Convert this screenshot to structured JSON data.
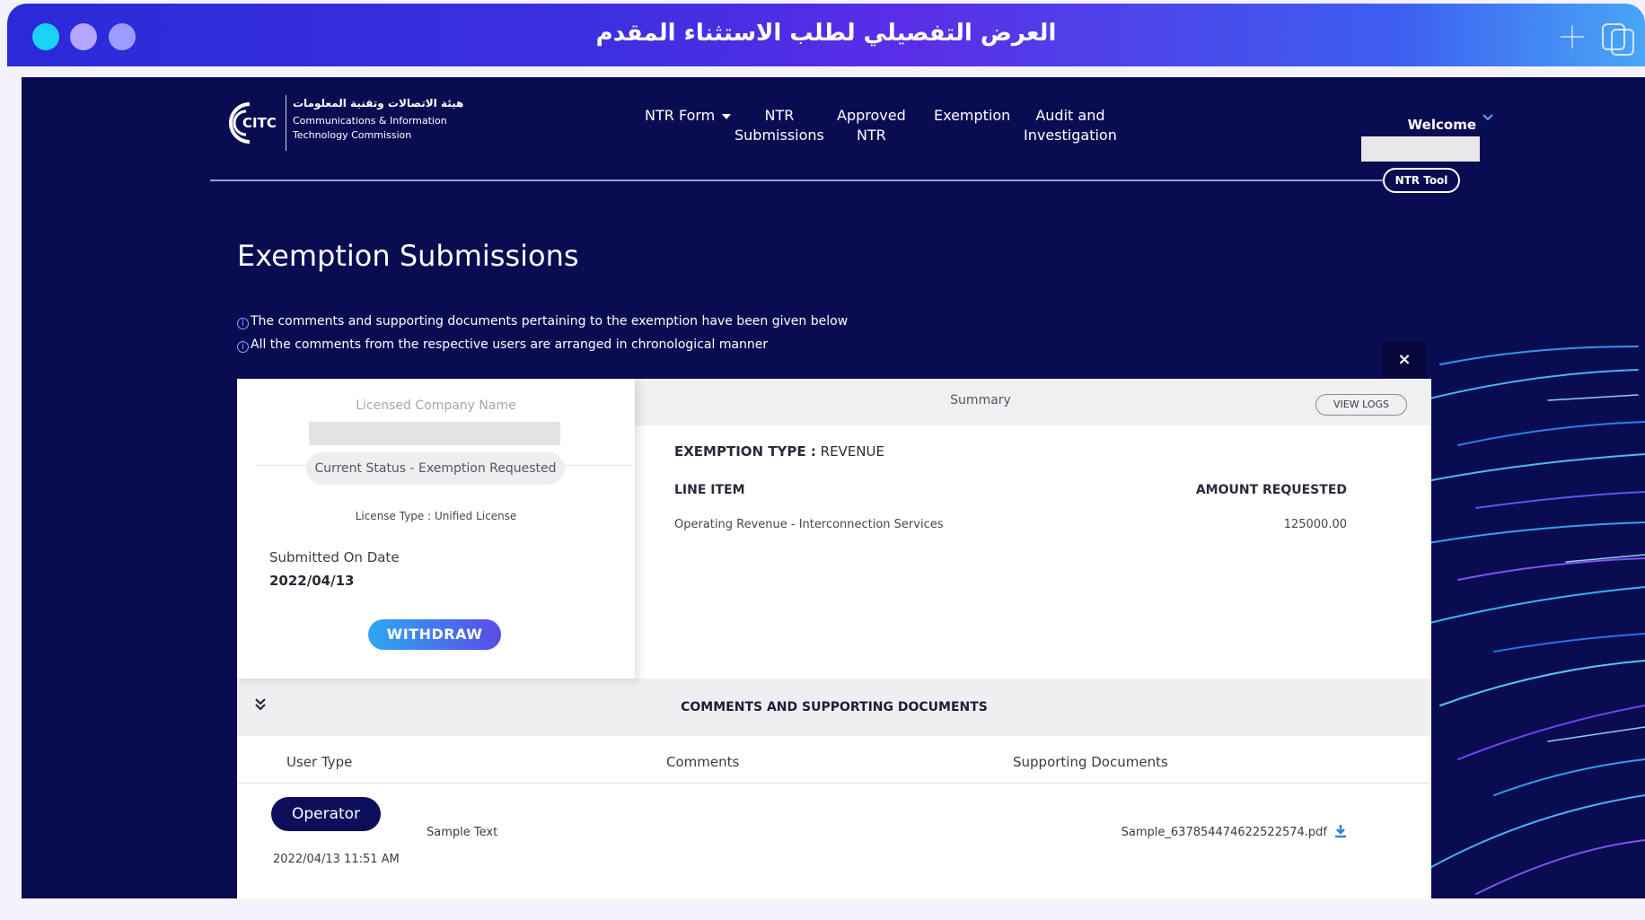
{
  "window": {
    "title": "العرض التفصيلي لطلب الاستثناء المقدم",
    "controls": [
      "close-dot",
      "minimize-dot",
      "maximize-dot"
    ],
    "accent_colors": {
      "dot1": "#19d3f5",
      "dot2": "#b7a4ff",
      "dot3": "#9b9cff"
    }
  },
  "header": {
    "logo": {
      "mark": "CITC",
      "arabic": "هيئة الاتصالات وتقنية المعلومات",
      "english_line1": "Communications & Information",
      "english_line2": "Technology Commission"
    },
    "nav": [
      {
        "line1": "NTR Form",
        "line2": "",
        "has_dropdown": true
      },
      {
        "line1": "NTR",
        "line2": "Submissions",
        "has_dropdown": false
      },
      {
        "line1": "Approved",
        "line2": "NTR",
        "has_dropdown": false
      },
      {
        "line1": "Exemption",
        "line2": "",
        "has_dropdown": false
      },
      {
        "line1": "Audit and",
        "line2": "Investigation",
        "has_dropdown": false
      }
    ],
    "welcome": "Welcome",
    "ntr_tool": "NTR Tool"
  },
  "page": {
    "title": "Exemption Submissions",
    "info_lines": [
      "The comments and supporting documents pertaining to the exemption have been given below",
      "All the comments from the respective users are arranged in chronological manner"
    ],
    "close_label": "×"
  },
  "left_panel": {
    "company_label": "Licensed Company Name",
    "status": "Current Status - Exemption Requested",
    "license_type": "License Type : Unified License",
    "submitted_label": "Submitted On Date",
    "submitted_date": "2022/04/13",
    "withdraw": "WITHDRAW"
  },
  "summary": {
    "title": "Summary",
    "view_logs": "VIEW LOGS",
    "exemption_type_label": "EXEMPTION TYPE :",
    "exemption_type_value": "REVENUE",
    "line_item_header": "LINE ITEM",
    "amount_header": "AMOUNT REQUESTED",
    "line_item": "Operating Revenue - Interconnection Services",
    "amount": "125000.00"
  },
  "comments": {
    "title": "COMMENTS AND SUPPORTING DOCUMENTS",
    "headers": [
      "User Type",
      "Comments",
      "Supporting Documents"
    ],
    "rows": [
      {
        "user_type": "Operator",
        "date": "2022/04/13 11:51 AM",
        "comment": "Sample Text",
        "document": "Sample_637854474622522574.pdf"
      }
    ]
  }
}
